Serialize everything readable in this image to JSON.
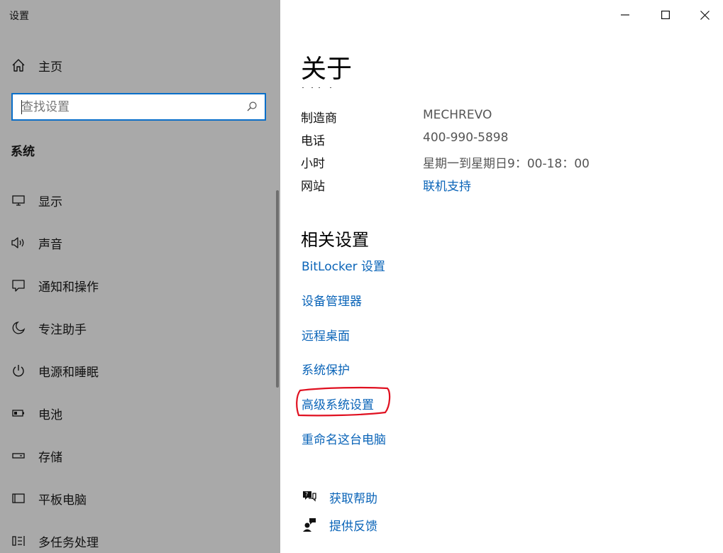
{
  "window": {
    "title": "设置",
    "minimize_glyph": "—",
    "maximize_glyph": "☐",
    "close_glyph": "✕"
  },
  "sidebar": {
    "home_label": "主页",
    "search_placeholder": "查找设置",
    "section_title": "系统",
    "items": [
      {
        "label": "显示",
        "icon": "display-icon"
      },
      {
        "label": "声音",
        "icon": "speaker-icon"
      },
      {
        "label": "通知和操作",
        "icon": "notification-icon"
      },
      {
        "label": "专注助手",
        "icon": "moon-icon"
      },
      {
        "label": "电源和睡眠",
        "icon": "power-icon"
      },
      {
        "label": "电池",
        "icon": "battery-icon"
      },
      {
        "label": "存储",
        "icon": "storage-icon"
      },
      {
        "label": "平板电脑",
        "icon": "tablet-icon"
      },
      {
        "label": "多任务处理",
        "icon": "multitask-icon"
      }
    ]
  },
  "main": {
    "title": "关于",
    "support": {
      "rows": [
        {
          "key": "制造商",
          "value": "MECHREVO"
        },
        {
          "key": "电话",
          "value": "400-990-5898"
        },
        {
          "key": "小时",
          "value": "星期一到星期日9：00-18：00"
        },
        {
          "key": "网站",
          "value": "联机支持"
        }
      ]
    },
    "related_title": "相关设置",
    "related_links": [
      "BitLocker 设置",
      "设备管理器",
      "远程桌面",
      "系统保护",
      "高级系统设置",
      "重命名这台电脑"
    ],
    "help": {
      "get_help": "获取帮助",
      "feedback": "提供反馈"
    }
  },
  "colors": {
    "sidebar_bg": "#a9a9a9",
    "accent": "#0a64b8",
    "search_border": "#0a6fc9",
    "annotation_red": "#e01020"
  }
}
